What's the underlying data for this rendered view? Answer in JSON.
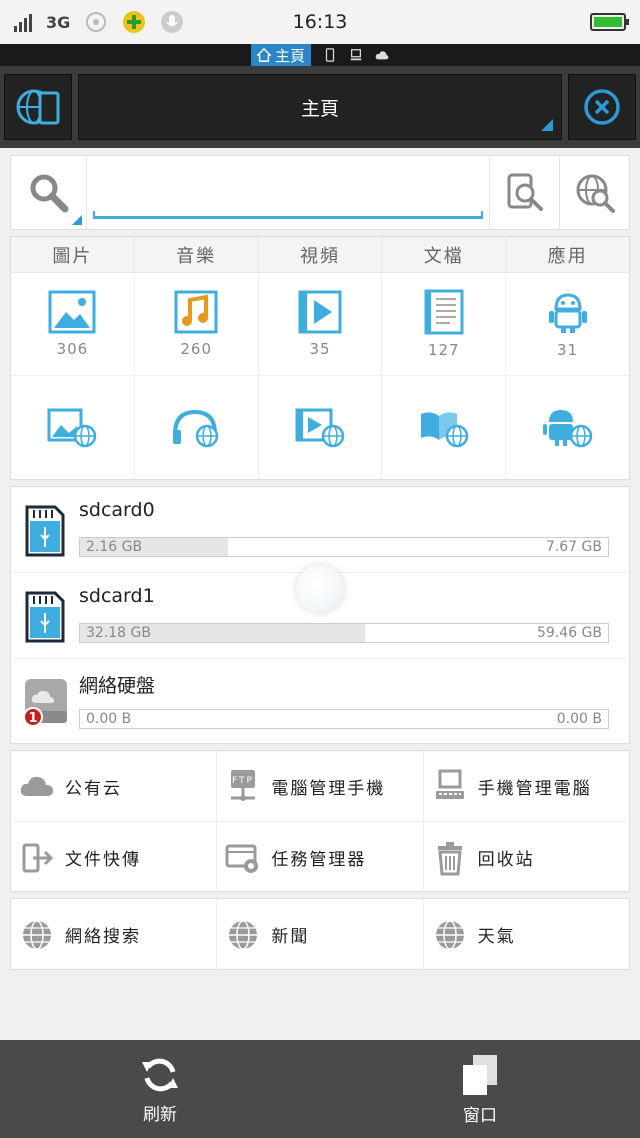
{
  "status_bar": {
    "network": "3G",
    "time": "16:13"
  },
  "location_strip": {
    "active_label": "主頁"
  },
  "toolbar": {
    "title": "主頁"
  },
  "search": {
    "value": "",
    "placeholder": ""
  },
  "categories": [
    {
      "label": "圖片",
      "count": "306",
      "icon": "image-icon",
      "web_icon": "web-image-icon"
    },
    {
      "label": "音樂",
      "count": "260",
      "icon": "music-icon",
      "web_icon": "web-music-icon"
    },
    {
      "label": "視頻",
      "count": "35",
      "icon": "video-icon",
      "web_icon": "web-video-icon"
    },
    {
      "label": "文檔",
      "count": "127",
      "icon": "document-icon",
      "web_icon": "web-book-icon"
    },
    {
      "label": "應用",
      "count": "31",
      "icon": "android-icon",
      "web_icon": "web-android-icon"
    }
  ],
  "storage": [
    {
      "name": "sdcard0",
      "used": "2.16 GB",
      "total": "7.67 GB",
      "fraction": 0.28
    },
    {
      "name": "sdcard1",
      "used": "32.18 GB",
      "total": "59.46 GB",
      "fraction": 0.54
    },
    {
      "name": "網絡硬盤",
      "used": "0.00 B",
      "total": "0.00 B",
      "fraction": 0,
      "badge": "1"
    }
  ],
  "tools": [
    {
      "label": "公有云",
      "icon": "cloud-icon"
    },
    {
      "label": "電腦管理手機",
      "icon": "ftp-icon"
    },
    {
      "label": "手機管理電腦",
      "icon": "computer-icon"
    },
    {
      "label": "文件快傳",
      "icon": "transfer-icon"
    },
    {
      "label": "任務管理器",
      "icon": "task-manager-icon"
    },
    {
      "label": "回收站",
      "icon": "trash-icon"
    }
  ],
  "web": [
    {
      "label": "網絡搜索",
      "icon": "globe-icon"
    },
    {
      "label": "新聞",
      "icon": "globe-icon"
    },
    {
      "label": "天氣",
      "icon": "globe-icon"
    }
  ],
  "bottom_nav": {
    "refresh_label": "刷新",
    "windows_label": "窗口"
  },
  "colors": {
    "accent": "#2a9bd8",
    "icon_blue": "#3eaee0",
    "toolbar_bg": "#3b3b3b",
    "bottom_bg": "#4a4a4a"
  }
}
